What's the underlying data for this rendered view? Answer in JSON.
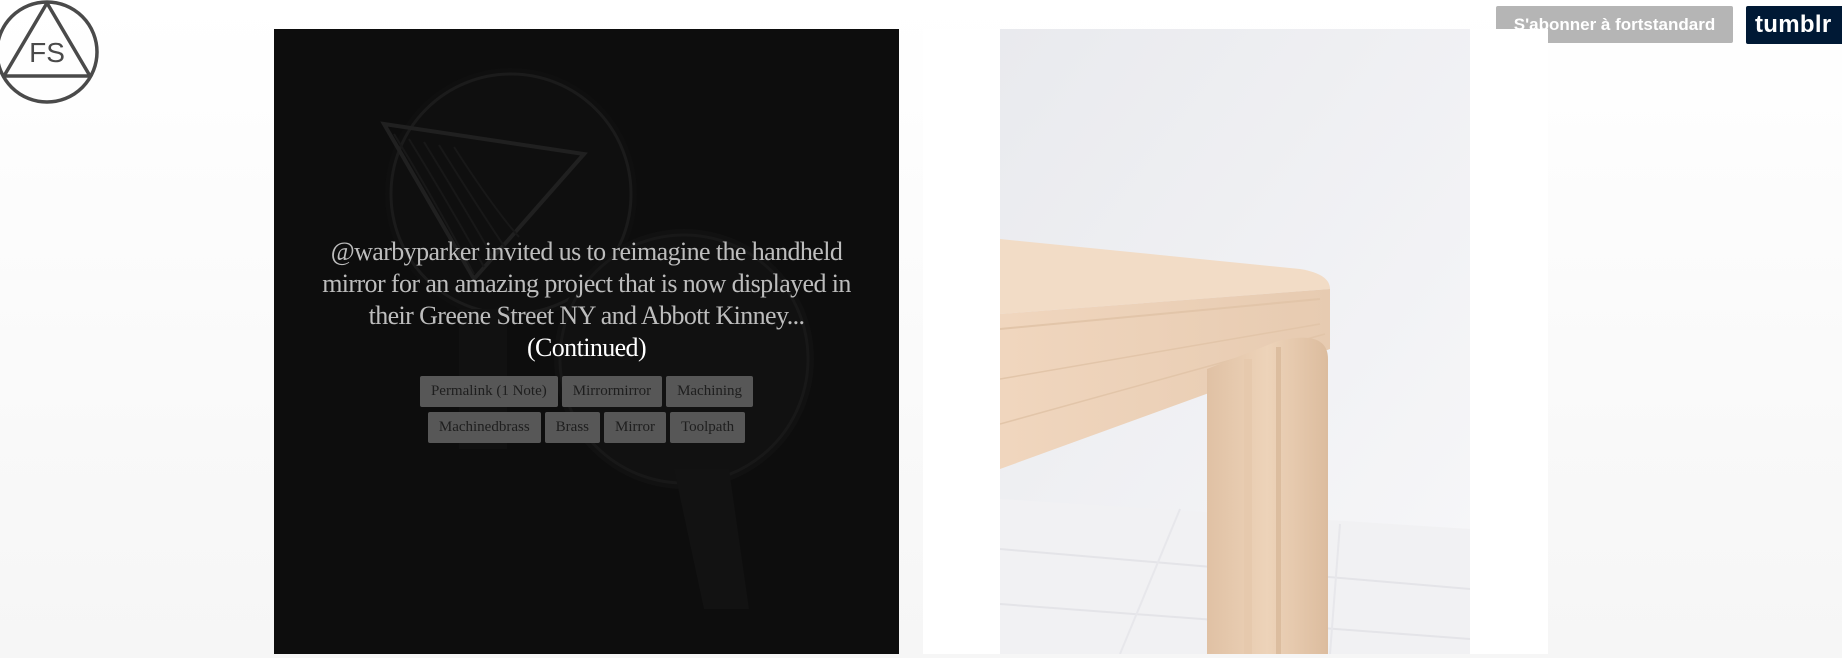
{
  "header": {
    "logo_text": "FS",
    "subscribe_label": "S'abonner à fortstandard",
    "tumblr_label": "tumblr"
  },
  "posts": [
    {
      "type": "text-over-image",
      "caption": "@warbyparker invited us to reimagine the handheld mirror for an amazing project that is now displayed in their Greene Street NY and Abbott Kinney...",
      "continued_label": "(Continued)",
      "tags": [
        "Permalink (1 Note)",
        "Mirrormirror",
        "Machining",
        "Machinedbrass",
        "Brass",
        "Mirror",
        "Toolpath"
      ]
    },
    {
      "type": "photo"
    }
  ],
  "colors": {
    "dark_post_bg": "#0d0d0d",
    "tag_bg": "#575757",
    "subscribe_bg": "#b5b5b5",
    "tumblr_bg": "#001935",
    "wood": "#ebd0b6"
  }
}
